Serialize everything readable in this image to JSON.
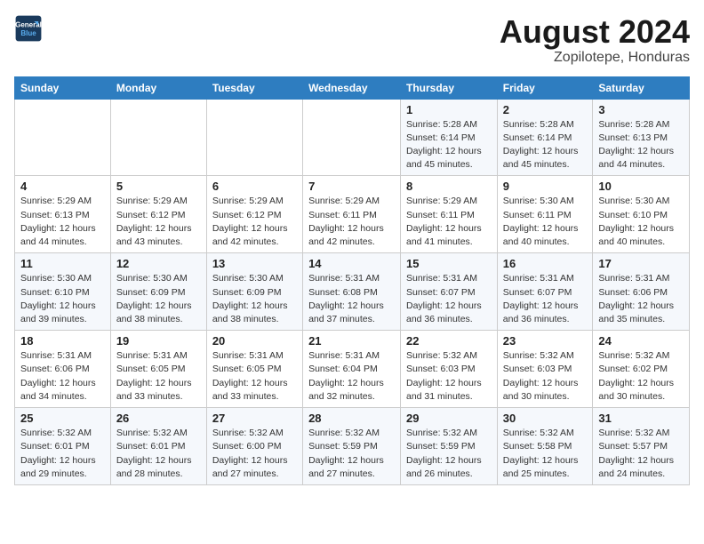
{
  "header": {
    "logo_line1": "General",
    "logo_line2": "Blue",
    "month": "August 2024",
    "location": "Zopilotepe, Honduras"
  },
  "weekdays": [
    "Sunday",
    "Monday",
    "Tuesday",
    "Wednesday",
    "Thursday",
    "Friday",
    "Saturday"
  ],
  "weeks": [
    [
      {
        "day": "",
        "info": ""
      },
      {
        "day": "",
        "info": ""
      },
      {
        "day": "",
        "info": ""
      },
      {
        "day": "",
        "info": ""
      },
      {
        "day": "1",
        "info": "Sunrise: 5:28 AM\nSunset: 6:14 PM\nDaylight: 12 hours\nand 45 minutes."
      },
      {
        "day": "2",
        "info": "Sunrise: 5:28 AM\nSunset: 6:14 PM\nDaylight: 12 hours\nand 45 minutes."
      },
      {
        "day": "3",
        "info": "Sunrise: 5:28 AM\nSunset: 6:13 PM\nDaylight: 12 hours\nand 44 minutes."
      }
    ],
    [
      {
        "day": "4",
        "info": "Sunrise: 5:29 AM\nSunset: 6:13 PM\nDaylight: 12 hours\nand 44 minutes."
      },
      {
        "day": "5",
        "info": "Sunrise: 5:29 AM\nSunset: 6:12 PM\nDaylight: 12 hours\nand 43 minutes."
      },
      {
        "day": "6",
        "info": "Sunrise: 5:29 AM\nSunset: 6:12 PM\nDaylight: 12 hours\nand 42 minutes."
      },
      {
        "day": "7",
        "info": "Sunrise: 5:29 AM\nSunset: 6:11 PM\nDaylight: 12 hours\nand 42 minutes."
      },
      {
        "day": "8",
        "info": "Sunrise: 5:29 AM\nSunset: 6:11 PM\nDaylight: 12 hours\nand 41 minutes."
      },
      {
        "day": "9",
        "info": "Sunrise: 5:30 AM\nSunset: 6:11 PM\nDaylight: 12 hours\nand 40 minutes."
      },
      {
        "day": "10",
        "info": "Sunrise: 5:30 AM\nSunset: 6:10 PM\nDaylight: 12 hours\nand 40 minutes."
      }
    ],
    [
      {
        "day": "11",
        "info": "Sunrise: 5:30 AM\nSunset: 6:10 PM\nDaylight: 12 hours\nand 39 minutes."
      },
      {
        "day": "12",
        "info": "Sunrise: 5:30 AM\nSunset: 6:09 PM\nDaylight: 12 hours\nand 38 minutes."
      },
      {
        "day": "13",
        "info": "Sunrise: 5:30 AM\nSunset: 6:09 PM\nDaylight: 12 hours\nand 38 minutes."
      },
      {
        "day": "14",
        "info": "Sunrise: 5:31 AM\nSunset: 6:08 PM\nDaylight: 12 hours\nand 37 minutes."
      },
      {
        "day": "15",
        "info": "Sunrise: 5:31 AM\nSunset: 6:07 PM\nDaylight: 12 hours\nand 36 minutes."
      },
      {
        "day": "16",
        "info": "Sunrise: 5:31 AM\nSunset: 6:07 PM\nDaylight: 12 hours\nand 36 minutes."
      },
      {
        "day": "17",
        "info": "Sunrise: 5:31 AM\nSunset: 6:06 PM\nDaylight: 12 hours\nand 35 minutes."
      }
    ],
    [
      {
        "day": "18",
        "info": "Sunrise: 5:31 AM\nSunset: 6:06 PM\nDaylight: 12 hours\nand 34 minutes."
      },
      {
        "day": "19",
        "info": "Sunrise: 5:31 AM\nSunset: 6:05 PM\nDaylight: 12 hours\nand 33 minutes."
      },
      {
        "day": "20",
        "info": "Sunrise: 5:31 AM\nSunset: 6:05 PM\nDaylight: 12 hours\nand 33 minutes."
      },
      {
        "day": "21",
        "info": "Sunrise: 5:31 AM\nSunset: 6:04 PM\nDaylight: 12 hours\nand 32 minutes."
      },
      {
        "day": "22",
        "info": "Sunrise: 5:32 AM\nSunset: 6:03 PM\nDaylight: 12 hours\nand 31 minutes."
      },
      {
        "day": "23",
        "info": "Sunrise: 5:32 AM\nSunset: 6:03 PM\nDaylight: 12 hours\nand 30 minutes."
      },
      {
        "day": "24",
        "info": "Sunrise: 5:32 AM\nSunset: 6:02 PM\nDaylight: 12 hours\nand 30 minutes."
      }
    ],
    [
      {
        "day": "25",
        "info": "Sunrise: 5:32 AM\nSunset: 6:01 PM\nDaylight: 12 hours\nand 29 minutes."
      },
      {
        "day": "26",
        "info": "Sunrise: 5:32 AM\nSunset: 6:01 PM\nDaylight: 12 hours\nand 28 minutes."
      },
      {
        "day": "27",
        "info": "Sunrise: 5:32 AM\nSunset: 6:00 PM\nDaylight: 12 hours\nand 27 minutes."
      },
      {
        "day": "28",
        "info": "Sunrise: 5:32 AM\nSunset: 5:59 PM\nDaylight: 12 hours\nand 27 minutes."
      },
      {
        "day": "29",
        "info": "Sunrise: 5:32 AM\nSunset: 5:59 PM\nDaylight: 12 hours\nand 26 minutes."
      },
      {
        "day": "30",
        "info": "Sunrise: 5:32 AM\nSunset: 5:58 PM\nDaylight: 12 hours\nand 25 minutes."
      },
      {
        "day": "31",
        "info": "Sunrise: 5:32 AM\nSunset: 5:57 PM\nDaylight: 12 hours\nand 24 minutes."
      }
    ]
  ]
}
